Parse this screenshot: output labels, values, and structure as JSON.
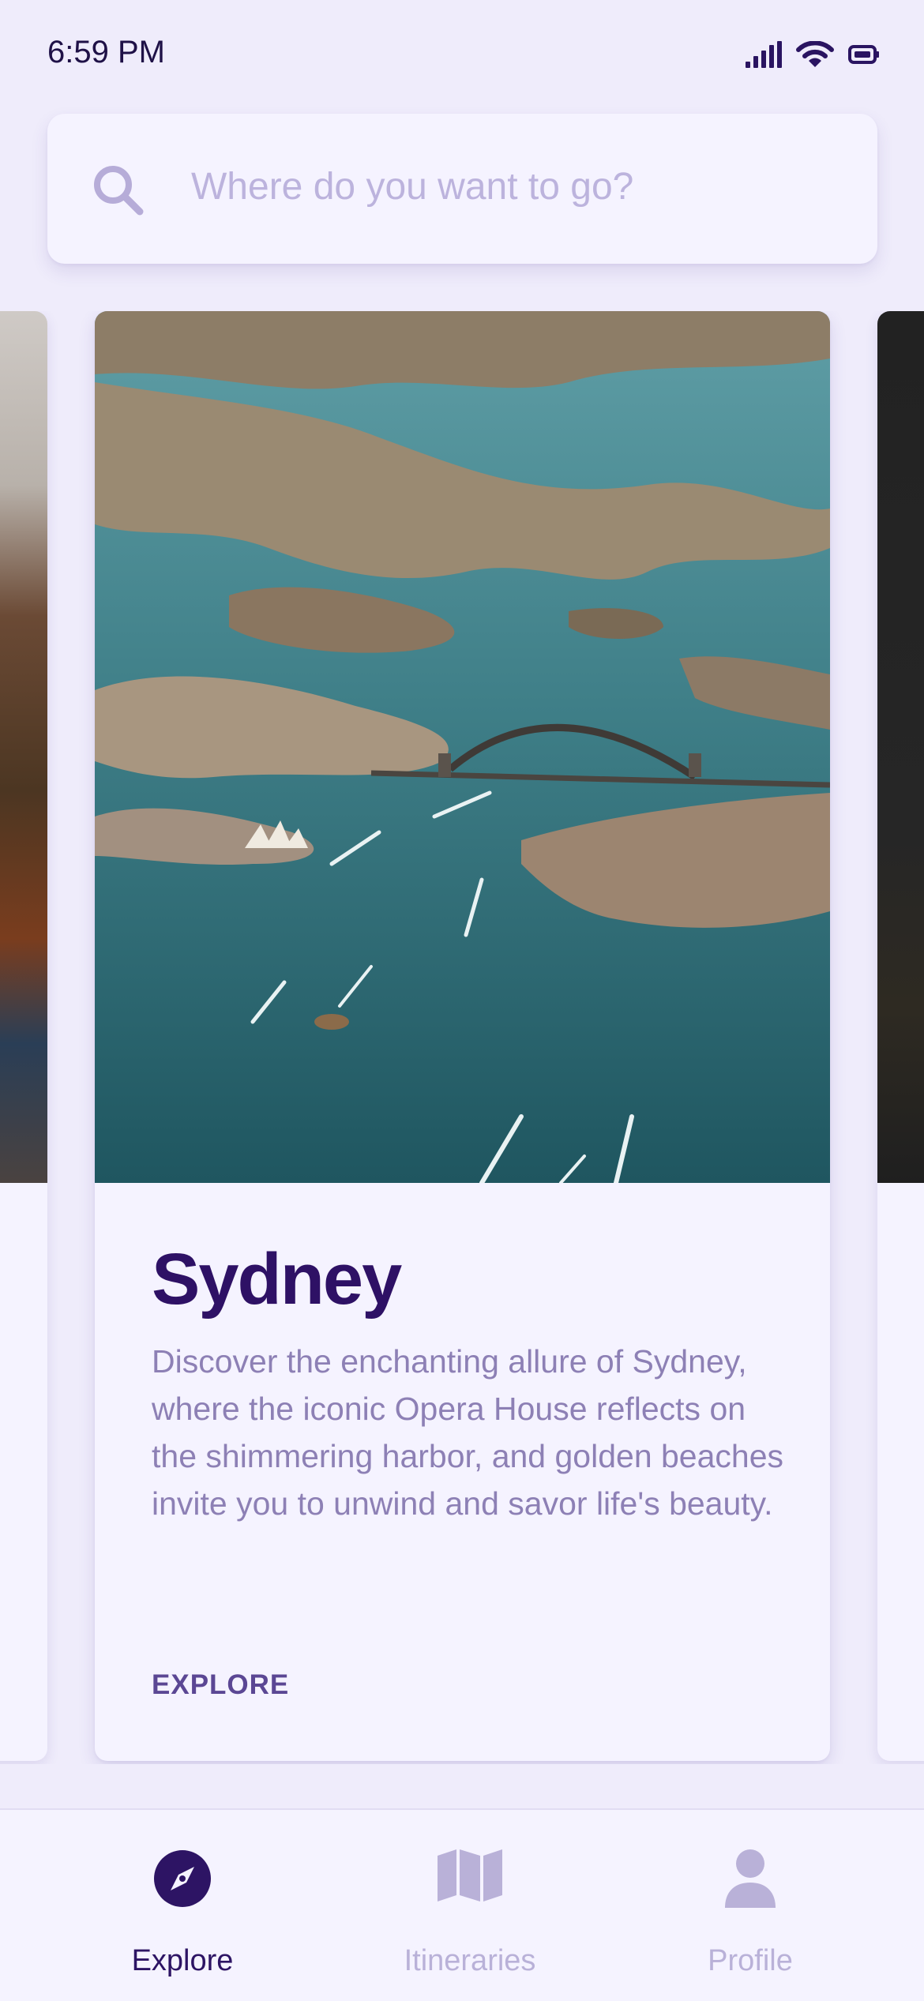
{
  "status_bar": {
    "time": "6:59 PM",
    "icons": [
      "cellular-signal-icon",
      "wifi-icon",
      "battery-icon"
    ]
  },
  "search": {
    "placeholder": "Where do you want to go?",
    "value": "",
    "icon": "search-icon"
  },
  "cards": [
    {
      "title": "Sydney",
      "description": "Discover the enchanting allure of Sydney, where the iconic Opera House reflects on the shimmering harbor, and golden beaches invite you to unwind and savor life's beauty.",
      "action_label": "EXPLORE"
    }
  ],
  "bottom_nav": {
    "items": [
      {
        "label": "Explore",
        "icon": "compass-icon",
        "active": true
      },
      {
        "label": "Itineraries",
        "icon": "map-icon",
        "active": false
      },
      {
        "label": "Profile",
        "icon": "person-icon",
        "active": false
      }
    ]
  },
  "colors": {
    "background": "#efecfb",
    "surface": "#f5f3ff",
    "title": "#2e1165",
    "body_text": "#8d80b5",
    "accent": "#5b4794",
    "nav_active": "#2d1464",
    "nav_inactive": "#b9b1d8"
  }
}
